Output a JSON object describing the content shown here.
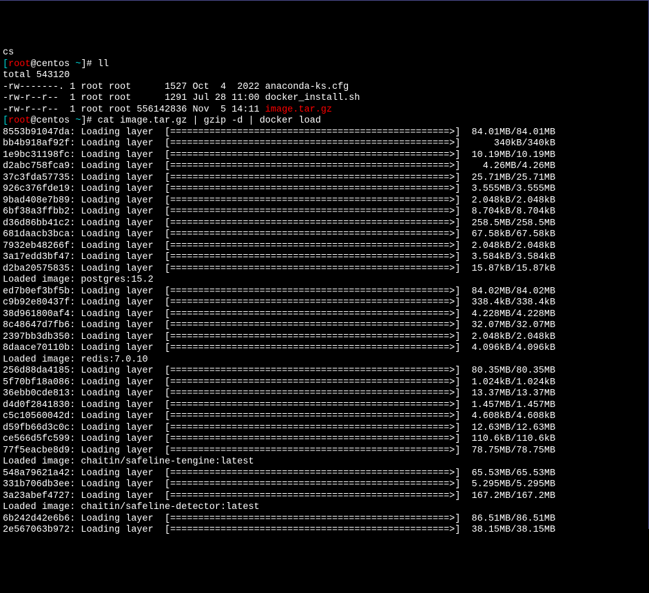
{
  "truncated_top": "cs",
  "prompt1": {
    "open": "[",
    "user": "root",
    "at": "@centos ",
    "path": "~",
    "close": "]# ",
    "cmd": "ll"
  },
  "ll_output": {
    "total": "total 543120",
    "rows": [
      {
        "perms": "-rw-------.",
        "links": "1",
        "owner": "root",
        "group": "root",
        "size": "1527",
        "date": "Oct  4  2022",
        "name": "anaconda-ks.cfg",
        "highlight": false
      },
      {
        "perms": "-rw-r--r-- ",
        "links": "1",
        "owner": "root",
        "group": "root",
        "size": "1291",
        "date": "Jul 28 11:00",
        "name": "docker_install.sh",
        "highlight": false
      },
      {
        "perms": "-rw-r--r-- ",
        "links": "1",
        "owner": "root",
        "group": "root",
        "size": "556142836",
        "date": "Nov  5 14:11",
        "name": "image.tar.gz",
        "highlight": true
      }
    ]
  },
  "prompt2": {
    "open": "[",
    "user": "root",
    "at": "@centos ",
    "path": "~",
    "close": "]# ",
    "cmd": "cat image.tar.gz | gzip -d | docker load"
  },
  "layers": [
    {
      "hash": "8553b91047da",
      "status": "Loading layer",
      "size": "84.01MB/84.01MB"
    },
    {
      "hash": "bb4b918af92f",
      "status": "Loading layer",
      "size": "340kB/340kB"
    },
    {
      "hash": "1e9bc31198fc",
      "status": "Loading layer",
      "size": "10.19MB/10.19MB"
    },
    {
      "hash": "d2abc758fca9",
      "status": "Loading layer",
      "size": "4.26MB/4.26MB"
    },
    {
      "hash": "37c3fda57735",
      "status": "Loading layer",
      "size": "25.71MB/25.71MB"
    },
    {
      "hash": "926c376fde19",
      "status": "Loading layer",
      "size": "3.555MB/3.555MB"
    },
    {
      "hash": "9bad408e7b89",
      "status": "Loading layer",
      "size": "2.048kB/2.048kB"
    },
    {
      "hash": "6bf38a3ffbb2",
      "status": "Loading layer",
      "size": "8.704kB/8.704kB"
    },
    {
      "hash": "d36d86bb41c2",
      "status": "Loading layer",
      "size": "258.5MB/258.5MB"
    },
    {
      "hash": "681daacb3bca",
      "status": "Loading layer",
      "size": "67.58kB/67.58kB"
    },
    {
      "hash": "7932eb48266f",
      "status": "Loading layer",
      "size": "2.048kB/2.048kB"
    },
    {
      "hash": "3a17edd3bf47",
      "status": "Loading layer",
      "size": "3.584kB/3.584kB"
    },
    {
      "hash": "d2ba20575835",
      "status": "Loading layer",
      "size": "15.87kB/15.87kB"
    },
    {
      "loaded": "Loaded image: postgres:15.2"
    },
    {
      "hash": "ed7b0ef3bf5b",
      "status": "Loading layer",
      "size": "84.02MB/84.02MB"
    },
    {
      "hash": "c9b92e80437f",
      "status": "Loading layer",
      "size": "338.4kB/338.4kB"
    },
    {
      "hash": "38d961800af4",
      "status": "Loading layer",
      "size": "4.228MB/4.228MB"
    },
    {
      "hash": "8c48647d7fb6",
      "status": "Loading layer",
      "size": "32.07MB/32.07MB"
    },
    {
      "hash": "2397bb3db350",
      "status": "Loading layer",
      "size": "2.048kB/2.048kB"
    },
    {
      "hash": "8daace70110b",
      "status": "Loading layer",
      "size": "4.096kB/4.096kB"
    },
    {
      "loaded": "Loaded image: redis:7.0.10"
    },
    {
      "hash": "256d88da4185",
      "status": "Loading layer",
      "size": "80.35MB/80.35MB"
    },
    {
      "hash": "5f70bf18a086",
      "status": "Loading layer",
      "size": "1.024kB/1.024kB"
    },
    {
      "hash": "36ebb0cde813",
      "status": "Loading layer",
      "size": "13.37MB/13.37MB"
    },
    {
      "hash": "d4d0f2841830",
      "status": "Loading layer",
      "size": "1.457MB/1.457MB"
    },
    {
      "hash": "c5c10560042d",
      "status": "Loading layer",
      "size": "4.608kB/4.608kB"
    },
    {
      "hash": "d59fb66d3c0c",
      "status": "Loading layer",
      "size": "12.63MB/12.63MB"
    },
    {
      "hash": "ce566d5fc599",
      "status": "Loading layer",
      "size": "110.6kB/110.6kB"
    },
    {
      "hash": "77f5eacbe8d9",
      "status": "Loading layer",
      "size": "78.75MB/78.75MB"
    },
    {
      "loaded": "Loaded image: chaitin/safeline-tengine:latest"
    },
    {
      "hash": "548a79621a42",
      "status": "Loading layer",
      "size": "65.53MB/65.53MB"
    },
    {
      "hash": "331b706db3ee",
      "status": "Loading layer",
      "size": "5.295MB/5.295MB"
    },
    {
      "hash": "3a23abef4727",
      "status": "Loading layer",
      "size": "167.2MB/167.2MB"
    },
    {
      "loaded": "Loaded image: chaitin/safeline-detector:latest"
    },
    {
      "hash": "6b242d42e6b6",
      "status": "Loading layer",
      "size": "86.51MB/86.51MB"
    },
    {
      "hash": "2e567063b972",
      "status": "Loading layer",
      "size": "38.15MB/38.15MB"
    }
  ],
  "progress_bar": "[==================================================>]"
}
